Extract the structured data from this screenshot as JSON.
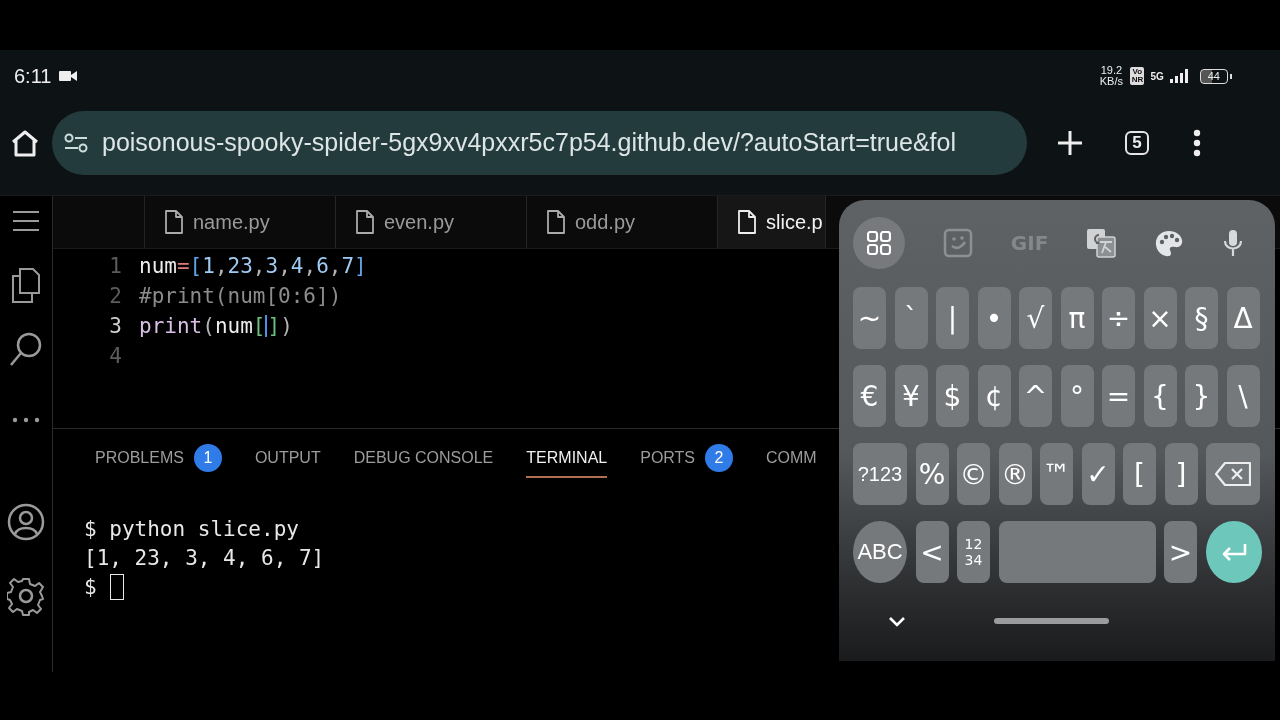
{
  "status_bar": {
    "time": "6:11",
    "network_speed": "19.2 KB/s",
    "network_badge": "Vo NR",
    "network_type": "5G",
    "battery": "44"
  },
  "browser": {
    "url": "poisonous-spooky-spider-5gx9xv4pxxr5c7p54.github.dev/?autoStart=true&fol",
    "tab_count": "5"
  },
  "editor_tabs": [
    {
      "label": "name.py",
      "selected": false
    },
    {
      "label": "even.py",
      "selected": false
    },
    {
      "label": "odd.py",
      "selected": false
    },
    {
      "label": "slice.p",
      "selected": true
    }
  ],
  "code_lines": [
    {
      "number": "1",
      "current": false,
      "tokens": [
        {
          "text": "num",
          "kind": "ident"
        },
        {
          "text": "=",
          "kind": "op"
        },
        {
          "text": "[",
          "kind": "bracket"
        },
        {
          "text": "1",
          "kind": "number"
        },
        {
          "text": ",",
          "kind": "punct"
        },
        {
          "text": "23",
          "kind": "number"
        },
        {
          "text": ",",
          "kind": "punct"
        },
        {
          "text": "3",
          "kind": "number"
        },
        {
          "text": ",",
          "kind": "punct"
        },
        {
          "text": "4",
          "kind": "number"
        },
        {
          "text": ",",
          "kind": "punct"
        },
        {
          "text": "6",
          "kind": "number"
        },
        {
          "text": ",",
          "kind": "punct"
        },
        {
          "text": "7",
          "kind": "number"
        },
        {
          "text": "]",
          "kind": "bracket"
        }
      ]
    },
    {
      "number": "2",
      "current": false,
      "tokens": [
        {
          "text": "#print(num[0:6])",
          "kind": "comment"
        }
      ]
    },
    {
      "number": "3",
      "current": true,
      "tokens": [
        {
          "text": "print",
          "kind": "func"
        },
        {
          "text": "(",
          "kind": "punct"
        },
        {
          "text": "num",
          "kind": "ident"
        },
        {
          "text": "[",
          "kind": "bracket2",
          "caret_after": true
        },
        {
          "text": "]",
          "kind": "bracket2"
        },
        {
          "text": ")",
          "kind": "punct"
        }
      ]
    },
    {
      "number": "4",
      "current": false
    }
  ],
  "panel_tabs": [
    {
      "label": "PROBLEMS",
      "selected": false,
      "badge": "1"
    },
    {
      "label": "OUTPUT",
      "selected": false
    },
    {
      "label": "DEBUG CONSOLE",
      "selected": false
    },
    {
      "label": "TERMINAL",
      "selected": true
    },
    {
      "label": "PORTS",
      "selected": false,
      "badge": "2"
    },
    {
      "label": "COMM",
      "selected": false
    }
  ],
  "terminal_lines": [
    {
      "text": "$ python slice.py",
      "cursor": false
    },
    {
      "text": "[1, 23, 3, 4, 6, 7]",
      "cursor": false
    },
    {
      "text": "$",
      "cursor": true
    }
  ],
  "keyboard": {
    "gif_label": "GIF",
    "rows": [
      [
        {
          "label": "~",
          "kind": "char"
        },
        {
          "label": "`",
          "kind": "char"
        },
        {
          "label": "|",
          "kind": "char"
        },
        {
          "label": "•",
          "kind": "char"
        },
        {
          "label": "√",
          "kind": "char"
        },
        {
          "label": "π",
          "kind": "char"
        },
        {
          "label": "÷",
          "kind": "char"
        },
        {
          "label": "×",
          "kind": "char"
        },
        {
          "label": "§",
          "kind": "char"
        },
        {
          "label": "Δ",
          "kind": "char"
        }
      ],
      [
        {
          "label": "€",
          "kind": "char"
        },
        {
          "label": "¥",
          "kind": "char"
        },
        {
          "label": "$",
          "kind": "char"
        },
        {
          "label": "¢",
          "kind": "char"
        },
        {
          "label": "^",
          "kind": "char"
        },
        {
          "label": "°",
          "kind": "char"
        },
        {
          "label": "=",
          "kind": "char"
        },
        {
          "label": "{",
          "kind": "char"
        },
        {
          "label": "}",
          "kind": "char"
        },
        {
          "label": "\\",
          "kind": "char"
        }
      ],
      [
        {
          "label": "?123",
          "kind": "mode"
        },
        {
          "label": "%",
          "kind": "char"
        },
        {
          "label": "©",
          "kind": "char"
        },
        {
          "label": "®",
          "kind": "char"
        },
        {
          "label": "™",
          "kind": "char"
        },
        {
          "label": "✓",
          "kind": "char"
        },
        {
          "label": "[",
          "kind": "char"
        },
        {
          "label": "]",
          "kind": "char"
        },
        {
          "kind": "backspace"
        }
      ],
      [
        {
          "label": "ABC",
          "kind": "round"
        },
        {
          "label": "<",
          "kind": "char"
        },
        {
          "label": "12 34",
          "kind": "numpad"
        },
        {
          "kind": "space"
        },
        {
          "label": ">",
          "kind": "char"
        },
        {
          "kind": "enter"
        }
      ]
    ]
  }
}
